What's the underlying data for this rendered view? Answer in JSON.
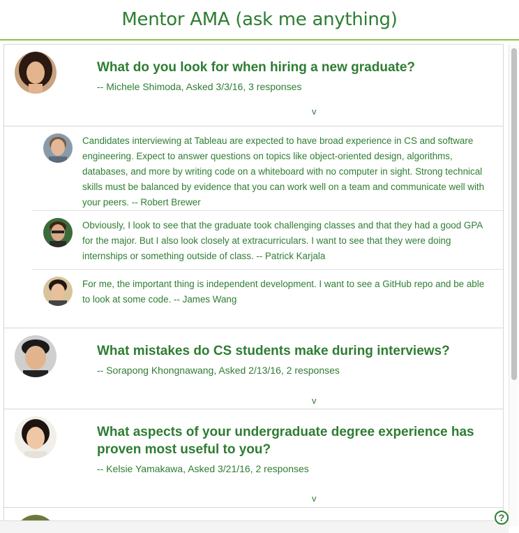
{
  "header": {
    "title": "Mentor AMA (ask me anything)"
  },
  "questions": [
    {
      "title": "What do you look for when hiring a new graduate?",
      "meta": "-- Michele Shimoda, Asked 3/3/16, 3 responses",
      "chevron": "v",
      "answers": [
        {
          "text": "Candidates interviewing at Tableau are expected to have broad experience in CS and software engineering. Expect to answer questions on topics like object-oriented design, algorithms, databases, and more by writing code on a whiteboard with no computer in sight. Strong technical skills must be balanced by evidence that you can work well on a team and communicate well with your peers. -- Robert Brewer"
        },
        {
          "text": "Obviously, I look to see that the graduate took challenging classes and that they had a good GPA for the major. But I also look closely at extracurriculars. I want to see that they were doing internships or something outside of class. -- Patrick Karjala"
        },
        {
          "text": "For me, the important thing is independent development. I want to see a GitHub repo and be able to look at some code. -- James Wang"
        }
      ]
    },
    {
      "title": "What mistakes do CS students make during interviews?",
      "meta": "-- Sorapong Khongnawang, Asked 2/13/16, 2 responses",
      "chevron": "v"
    },
    {
      "title": "What aspects of your undergraduate degree experience has proven most useful to you?",
      "meta": "-- Kelsie Yamakawa, Asked 3/21/16, 2 responses",
      "chevron": "v"
    }
  ],
  "help": {
    "icon": "?"
  },
  "colors": {
    "accent": "#2e7d32",
    "rule": "#8bc34a"
  }
}
